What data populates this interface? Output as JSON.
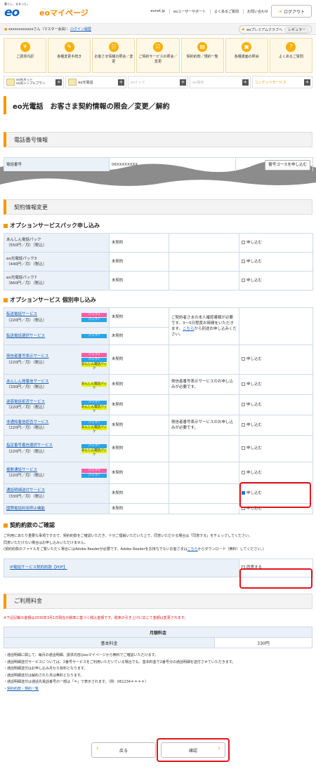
{
  "header": {
    "brand_tagline": "暮らし、まるっと。",
    "logo_text": "eo",
    "brand": "eoマイページ",
    "links": [
      "eonet.jp",
      "eoユーザーサポート",
      "よくあるご質問",
      "お問い合わせ"
    ],
    "logout": "ログアウト"
  },
  "user": {
    "name": "xxxxxxxxxxxxさん（マスター会員）：",
    "history": "ログイン履歴",
    "premium": "eoプレミアムクラブへ",
    "level": "レギュラー"
  },
  "menu": [
    {
      "label": "ご請求内訳",
      "icon": "¥"
    },
    {
      "label": "各種変更手続き",
      "icon": "✎"
    },
    {
      "label": "お客さま情報の照会／変更",
      "icon": "☷"
    },
    {
      "label": "ご契約サービスの照会／変更",
      "icon": "☑"
    },
    {
      "label": "契約約款／規約一覧",
      "icon": "▤"
    },
    {
      "label": "各種書面の照会",
      "icon": "▣"
    },
    {
      "label": "よくあるご質問",
      "icon": "?"
    }
  ],
  "services": [
    {
      "label": "eo光ネット\neo光シンプルプラン",
      "icon": "ネット"
    },
    {
      "label": "eo光電話",
      "icon": "電話"
    },
    {
      "label": "eoテレビ"
    },
    {
      "label": "eo電気"
    },
    {
      "label": "コンテンツサービス"
    }
  ],
  "page_title": "eo光電話　お客さま契約情報の照会／変更／解約",
  "phone_section": {
    "heading": "電話番号情報",
    "label": "電話番号",
    "number": "06XXXXXXXX",
    "button": "番号コースを申し込む"
  },
  "contract_section": {
    "heading": "契約情報変更"
  },
  "pack": {
    "heading": "オプションサービスパック申し込み",
    "rows": [
      {
        "name": "あんしん電話パック\n（550円／月）（税込）",
        "status": "未契約",
        "apply": "申し込む",
        "checked": false
      },
      {
        "name": "eo光電話パック3\n（440円／月）（税込）",
        "status": "未契約",
        "apply": "申し込む",
        "checked": false
      },
      {
        "name": "eo光電話パック7\n（660円／月）（税込）",
        "status": "未契約",
        "apply": "申し込む",
        "checked": false
      }
    ]
  },
  "individual": {
    "heading": "オプションサービス 個別申し込み",
    "rows": [
      {
        "name": "転送電話サービス",
        "price": "（220円／月）（税込）",
        "tags": [
          "パック3",
          "パック7"
        ],
        "status": "未契約",
        "note": "",
        "apply": "",
        "checked": false
      },
      {
        "name": "転送電話選択サービス",
        "price": "",
        "tags": [
          "パック7"
        ],
        "status": "未契約",
        "note": "",
        "apply": "",
        "checked": false
      },
      {
        "name": "発信者番号表示サービス",
        "price": "（220円／月）（税込）",
        "tags": [
          "パック3",
          "パック7",
          "あんしん電話パック"
        ],
        "status": "未契約",
        "note": "",
        "apply": "申し込む",
        "checked": false
      },
      {
        "name": "あんしん発着信サービス",
        "price": "（330円／月）（税込）",
        "tags": [
          "あんしん電話パック"
        ],
        "status": "未契約",
        "note": "発信者番号表示サービスのお申し込みが必要です。",
        "apply": "申し込む",
        "checked": false
      },
      {
        "name": "迷惑電話拒否サービス",
        "price": "（220円／月）（税込）",
        "tags": [
          "パック7",
          "あんしん電話パック"
        ],
        "status": "未契約",
        "note": "",
        "apply": "申し込む",
        "checked": false
      },
      {
        "name": "非通知着信拒否サービス",
        "price": "（220円／月）（税込）",
        "tags": [
          "パック7",
          "あんしん電話パック"
        ],
        "status": "未契約",
        "note": "発信者番号表示サービスのお申し込みが必要です。",
        "apply": "申し込む",
        "checked": false
      },
      {
        "name": "指定番号着信選択サービス",
        "price": "（220円／月）（税込）",
        "tags": [
          "パック7",
          "あんしん電話パック"
        ],
        "status": "未契約",
        "note": "",
        "apply": "申し込む",
        "checked": false
      },
      {
        "name": "複数通話サービス",
        "price": "（220円／月）（税込）",
        "tags": [
          "パック3",
          "パック7"
        ],
        "status": "未契約",
        "note": "",
        "apply": "申し込む",
        "checked": false
      },
      {
        "name": "通話明細送付サービス",
        "price": "（330円／月）（税込）",
        "tags": [],
        "status": "未契約",
        "note": "",
        "apply": "申し込む",
        "checked": true
      },
      {
        "name": "国際電話利用停止機能",
        "price": "",
        "tags": [],
        "status": "未契約",
        "note": "",
        "apply": "申し込む",
        "checked": false
      }
    ],
    "transfer_note_a": "ご契約者さまの本人確認書類が必要です。3～5日程度お時間をいただきます。",
    "transfer_note_link": "こちら",
    "transfer_note_b": "から別途お申し込みください。"
  },
  "terms": {
    "heading": "契約約款のご確認",
    "line1": "ご利用にあたり重要な事項ですので、契約約款をご確認いただき、十分ご理解いただいた上で、同意いただける場合は「同意する」をチェックしてください。",
    "line2": "同意いただけない場合はお申し込みいただけません。",
    "line3a": "(契約約款のファイルをご覧いただく場合にはAdobe Readerが必要です。Adobe Readerをお持ちでないお客さまは",
    "line3link": "こちら",
    "line3b": "からダウンロード（無料）してください。)",
    "doc": "IP電話サービス契約約款【PDF】",
    "agree": "同意する"
  },
  "fee": {
    "heading": "ご利用料金",
    "notice": "※下記記載の金額は2030年3月1日現在の税率に基づく税込金額です。税率の引き上げに応じて金額は変更されます。",
    "table_head": "月額料金",
    "base_label": "基本料金",
    "base_value": "330円"
  },
  "notes": [
    "通話明細に関して、毎月の通話明細、請求内容はeoマイページから無料でご確認いただけます。",
    "通話明細送付サービスについては、2番号サービスをご利用いただいている場合でも、基本料金で2番号分の通話明細を送付させていただきます。",
    "通話明細送付はお申し込み月から有料となります。",
    "通話明細送付は解約された月は無料となります。",
    "通話明細送付は通話先電話番号の一部は「＊」で表示されます。（例：061234＊＊＊＊）"
  ],
  "terms_link": "契約約款・規約一覧",
  "buttons": {
    "back": "戻る",
    "confirm": "確認"
  }
}
